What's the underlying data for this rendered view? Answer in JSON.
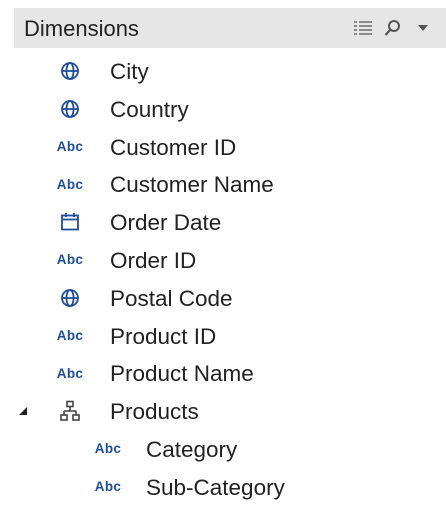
{
  "header": {
    "title": "Dimensions"
  },
  "toolbar": {
    "list_view_icon": "list-view-icon",
    "search_icon": "search-icon",
    "menu_icon": "chevron-down-icon"
  },
  "accent_color": "#1f4f9a",
  "fields": [
    {
      "label": "City",
      "type": "geo",
      "icon": "globe-icon"
    },
    {
      "label": "Country",
      "type": "geo",
      "icon": "globe-icon"
    },
    {
      "label": "Customer ID",
      "type": "string",
      "icon": "Abc"
    },
    {
      "label": "Customer Name",
      "type": "string",
      "icon": "Abc"
    },
    {
      "label": "Order Date",
      "type": "date",
      "icon": "calendar-icon"
    },
    {
      "label": "Order ID",
      "type": "string",
      "icon": "Abc"
    },
    {
      "label": "Postal Code",
      "type": "geo",
      "icon": "globe-icon"
    },
    {
      "label": "Product ID",
      "type": "string",
      "icon": "Abc"
    },
    {
      "label": "Product Name",
      "type": "string",
      "icon": "Abc"
    },
    {
      "label": "Products",
      "type": "hierarchy",
      "icon": "hierarchy-icon",
      "expanded": true
    },
    {
      "label": "Category",
      "type": "string",
      "icon": "Abc",
      "child": true
    },
    {
      "label": "Sub-Category",
      "type": "string",
      "icon": "Abc",
      "child": true
    }
  ],
  "abc_text": "Abc"
}
